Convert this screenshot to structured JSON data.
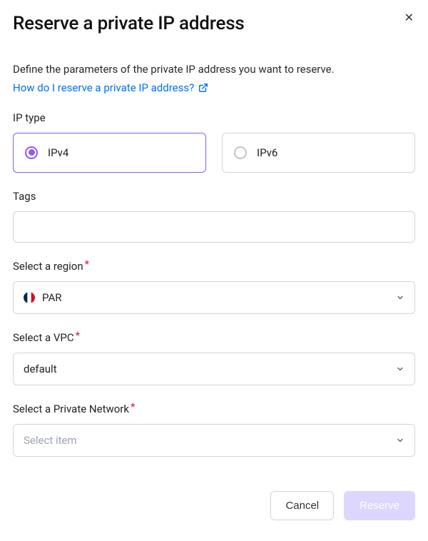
{
  "modal": {
    "title": "Reserve a private IP address",
    "description": "Define the parameters of the private IP address you want to reserve.",
    "help_link": "How do I reserve a private IP address?"
  },
  "ip_type": {
    "label": "IP type",
    "options": {
      "ipv4": "IPv4",
      "ipv6": "IPv6"
    },
    "selected": "ipv4"
  },
  "tags": {
    "label": "Tags",
    "value": ""
  },
  "region": {
    "label": "Select a region",
    "value": "PAR"
  },
  "vpc": {
    "label": "Select a VPC",
    "value": "default"
  },
  "private_network": {
    "label": "Select a Private Network",
    "placeholder": "Select item"
  },
  "footer": {
    "cancel": "Cancel",
    "reserve": "Reserve"
  }
}
